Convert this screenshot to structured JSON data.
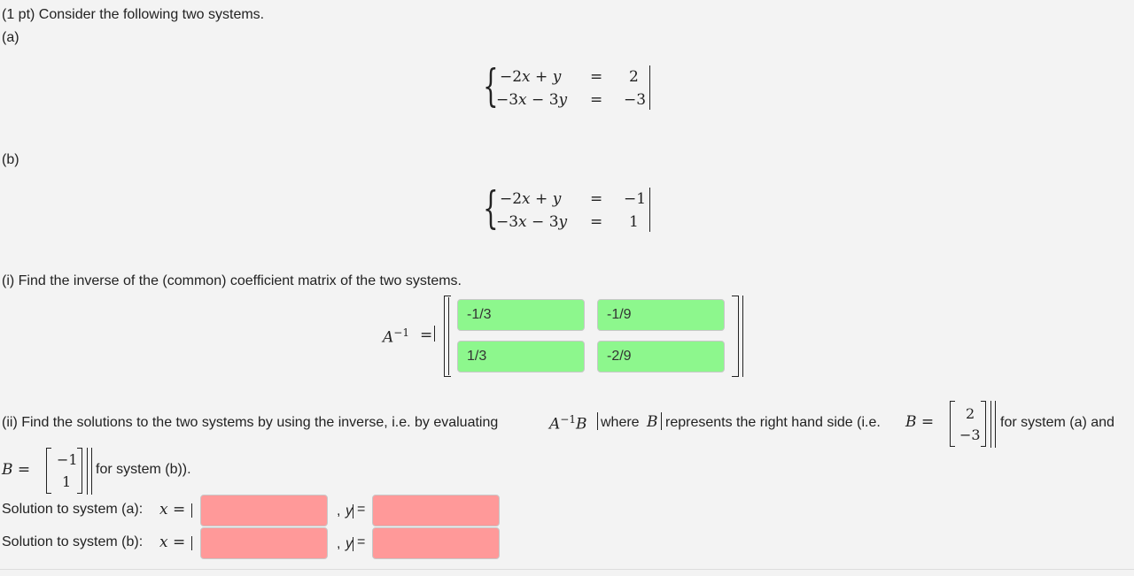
{
  "problem": {
    "intro": "(1 pt) Consider the following two systems.",
    "part_a_label": "(a)",
    "part_b_label": "(b)",
    "system_a": {
      "eq1_lhs": "−2𝑥 + 𝑦",
      "eq2_lhs": "−3𝑥 − 3𝑦",
      "eq1_rhs": "2",
      "eq2_rhs": "−3",
      "equals": "="
    },
    "system_b": {
      "eq1_lhs": "−2𝑥 + 𝑦",
      "eq2_lhs": "−3𝑥 − 3𝑦",
      "eq1_rhs": "−1",
      "eq2_rhs": "1",
      "equals": "="
    },
    "part_i": {
      "prompt": "(i) Find the inverse of the (common) coefficient matrix of the two systems.",
      "matrix_label": "A",
      "matrix_sup": "−1",
      "equals": "=",
      "entries": [
        "-1/3",
        "-1/9",
        "1/3",
        "-2/9"
      ]
    },
    "part_ii": {
      "text_1": "(ii) Find the solutions to the two systems by using the inverse, i.e. by evaluating",
      "expr_A": "A",
      "expr_sup": "−1",
      "expr_B": "B",
      "text_2": "where",
      "text_B": "B",
      "text_3": "represents the right hand side (i.e.",
      "B_eq": "B =",
      "vec_a": [
        "2",
        "−3"
      ],
      "text_4": "for system (a) and",
      "vec_b": [
        "−1",
        "1"
      ],
      "text_5": "for system (b))."
    },
    "solutions": {
      "row_a_label": "Solution to system (a):",
      "row_b_label": "Solution to system (b):",
      "x_label": "x",
      "y_label": "y",
      "equals": "=",
      "comma": ",",
      "a_x_value": "",
      "a_y_value": "",
      "b_x_value": "",
      "b_y_value": ""
    }
  },
  "colors": {
    "correct": "#8df78d",
    "incorrect": "#ff9999",
    "background": "#f3f3f3"
  }
}
